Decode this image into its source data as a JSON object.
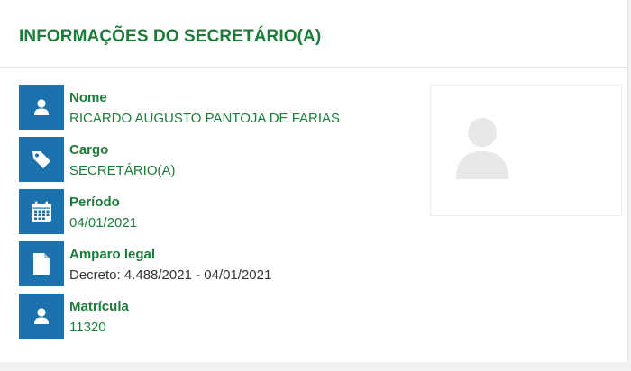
{
  "section": {
    "title": "INFORMAÇÕES DO SECRETÁRIO(A)"
  },
  "fields": [
    {
      "icon": "user-icon",
      "label": "Nome",
      "value": "RICARDO AUGUSTO PANTOJA DE FARIAS"
    },
    {
      "icon": "tag-icon",
      "label": "Cargo",
      "value": "SECRETÁRIO(A)"
    },
    {
      "icon": "calendar-icon",
      "label": "Período",
      "value": "04/01/2021"
    },
    {
      "icon": "document-icon",
      "label": "Amparo legal",
      "value": "Decreto: 4.488/2021 - 04/01/2021"
    },
    {
      "icon": "user-icon",
      "label": "Matrícula",
      "value": "11320"
    }
  ],
  "photo": {
    "icon": "avatar-placeholder-icon"
  },
  "colors": {
    "title_green": "#1c7d3a",
    "icon_blue": "#1b72ad",
    "placeholder_gray": "#e8e8e8"
  }
}
